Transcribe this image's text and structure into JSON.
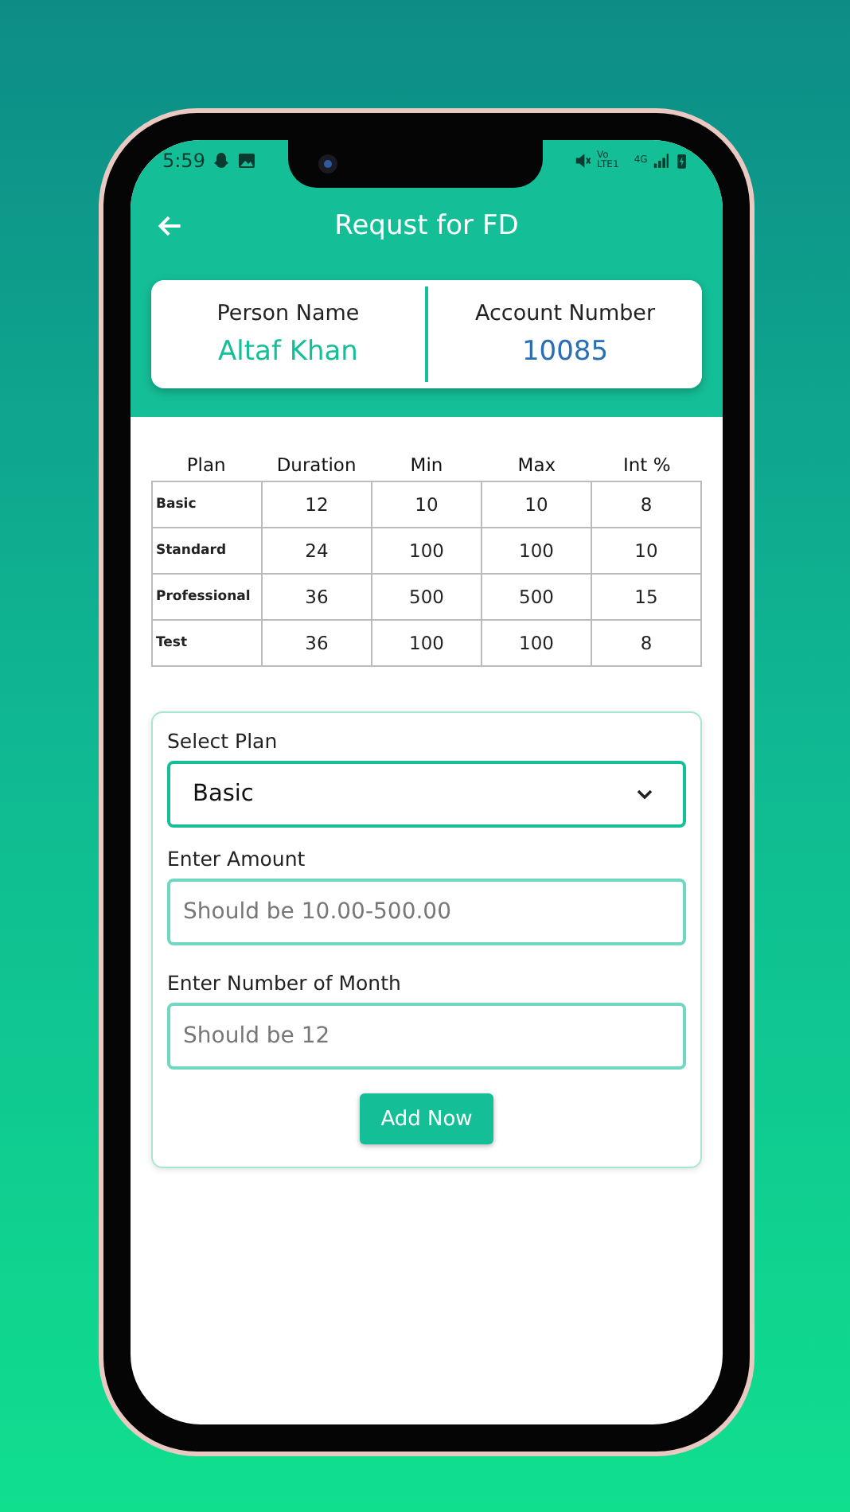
{
  "status_bar": {
    "time": "5:59",
    "volte": "Vo LTE1",
    "network": "4G"
  },
  "header": {
    "title": "Requst for FD"
  },
  "account_card": {
    "person_label": "Person Name",
    "person_value": "Altaf Khan",
    "account_label": "Account Number",
    "account_value": "10085"
  },
  "table": {
    "columns": [
      "Plan",
      "Duration",
      "Min",
      "Max",
      "Int %"
    ],
    "rows": [
      [
        "Basic",
        "12",
        "10",
        "10",
        "8"
      ],
      [
        "Standard",
        "24",
        "100",
        "100",
        "10"
      ],
      [
        "Professional",
        "36",
        "500",
        "500",
        "15"
      ],
      [
        "Test",
        "36",
        "100",
        "100",
        "8"
      ]
    ]
  },
  "form": {
    "plan_label": "Select Plan",
    "plan_value": "Basic",
    "amount_label": "Enter Amount",
    "amount_placeholder": "Should be 10.00-500.00",
    "month_label": "Enter Number of Month",
    "month_placeholder": "Should be 12",
    "submit": "Add Now"
  }
}
